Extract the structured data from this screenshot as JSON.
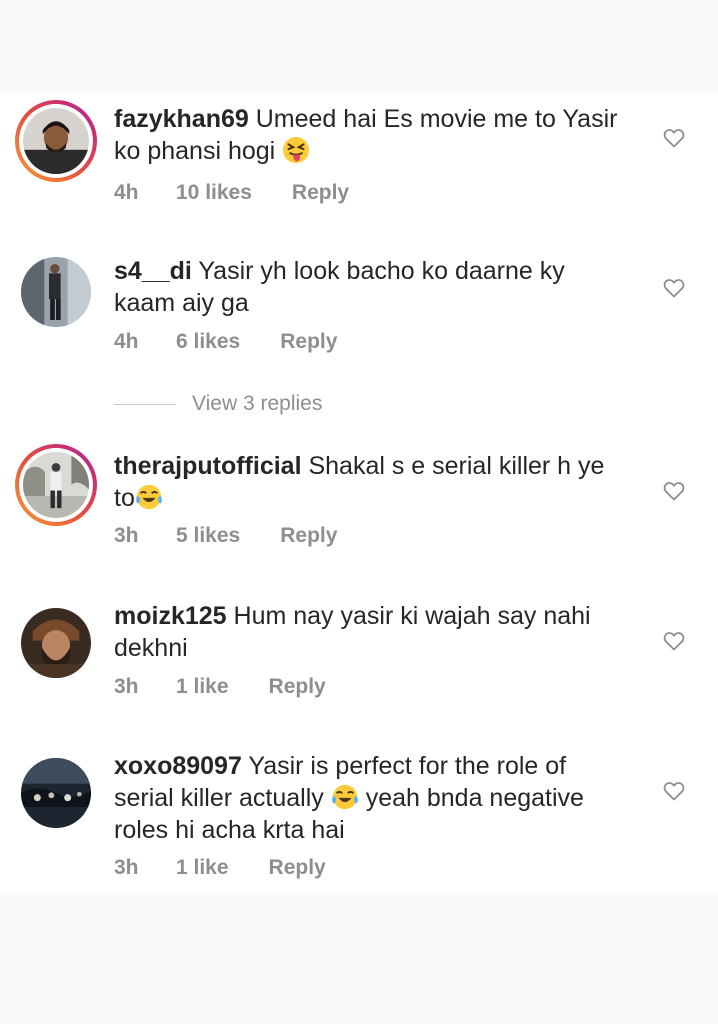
{
  "comments": [
    {
      "username": "fazykhan69",
      "text_1": "Umeed hai Es movie me to Yasir",
      "text_2": "ko phansi hogi",
      "emoji": "squinting-tongue-emoji",
      "time": "4h",
      "likes": "10 likes",
      "reply": "Reply"
    },
    {
      "username": "s4__di",
      "text_1": "Yasir yh look bacho ko daarne ky",
      "text_2": "kaam aiy ga",
      "time": "4h",
      "likes": "6 likes",
      "reply": "Reply"
    },
    {
      "username": "therajputofficial",
      "text_1": "Shakal s e serial killer h ye",
      "text_2": "to",
      "emoji": "tears-of-joy-emoji",
      "time": "3h",
      "likes": "5 likes",
      "reply": "Reply"
    },
    {
      "username": "moizk125",
      "text_1": "Hum nay yasir ki wajah say nahi",
      "text_2": "dekhni",
      "time": "3h",
      "likes": "1 like",
      "reply": "Reply"
    },
    {
      "username": "xoxo89097",
      "text_1": "Yasir is perfect for the role of",
      "text_2a": "serial killer actually",
      "text_2b": "yeah bnda negative",
      "text_3": "roles hi acha krta hai",
      "emoji": "tears-of-joy-emoji",
      "time": "3h",
      "likes": "1 like",
      "reply": "Reply"
    }
  ],
  "view_replies": "View 3 replies",
  "colors": {
    "text": "#262626",
    "secondary": "#8e8e8e",
    "story_ring": "#e8513b"
  }
}
